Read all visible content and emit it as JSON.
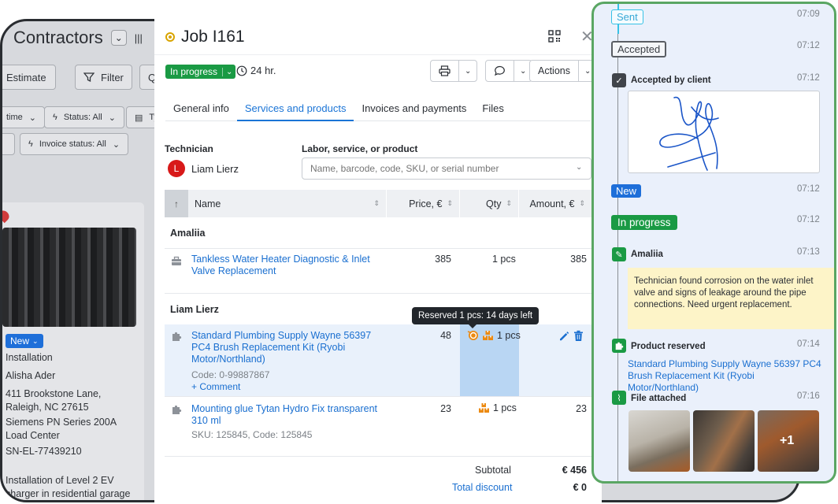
{
  "background_app": {
    "title": "Contractors",
    "buttons": {
      "estimate": "Estimate",
      "filter": "Filter",
      "q_fragment": "Q",
      "time_filter": "time",
      "status_filter": "Status: All",
      "type_fragment": "Ty",
      "invoice_status_filter": "Invoice status: All"
    },
    "card": {
      "status": "New",
      "type": "Installation",
      "customer": "Alisha Ader",
      "address": "411 Brookstone Lane, Raleigh, NC 27615",
      "equipment": "Siemens PN Series 200A Load Center",
      "serial": "SN-EL-77439210",
      "description": "Installation of Level 2 EV charger in residential garage"
    }
  },
  "job": {
    "title": "Job I161",
    "status": "In progress",
    "sla": "24 hr.",
    "actions_label": "Actions",
    "tabs": [
      "General info",
      "Services and products",
      "Invoices and payments",
      "Files"
    ],
    "active_tab": 1,
    "technician": {
      "label": "Technician",
      "name": "Liam Lierz",
      "initial": "L"
    },
    "labor": {
      "label": "Labor, service, or product",
      "placeholder": "Name, barcode, code, SKU, or serial number"
    },
    "table": {
      "columns": [
        "Name",
        "Price, €",
        "Qty",
        "Amount, €"
      ],
      "groups": [
        {
          "name": "Amaliia",
          "rows": [
            {
              "name": "Tankless Water Heater Diagnostic & Inlet Valve Replacement",
              "price": "385",
              "qty": "1 pcs",
              "amount": "385"
            }
          ]
        },
        {
          "name": "Liam Lierz",
          "rows": [
            {
              "name": "Standard Plumbing Supply Wayne 56397 PC4 Brush Replacement Kit (Ryobi Motor/Northland)",
              "code": "Code: 0-99887867",
              "comment": "+ Comment",
              "price": "48",
              "qty": "1 pcs",
              "amount": ""
            },
            {
              "name": "Mounting glue Tytan Hydro Fix transparent 310 ml",
              "code": "SKU: 125845, Code: 125845",
              "price": "23",
              "qty": "1 pcs",
              "amount": "23"
            }
          ]
        }
      ]
    },
    "tooltip": "Reserved 1 pcs: 14 days left",
    "totals": {
      "subtotal_label": "Subtotal",
      "subtotal_value": "€ 456",
      "discount_label": "Total discount",
      "discount_value": "€ 0"
    }
  },
  "timeline": {
    "events": [
      {
        "label": "Sent",
        "time": "07:09"
      },
      {
        "label": "Accepted",
        "time": "07:12"
      },
      {
        "label": "Accepted by client",
        "time": "07:12"
      },
      {
        "label": "New",
        "time": "07:12"
      },
      {
        "label": "In progress",
        "time": "07:12"
      },
      {
        "label": "Amaliia",
        "time": "07:13",
        "note": "Technician found corrosion on the water inlet valve and signs of leakage around the pipe connections. Need urgent replacement."
      },
      {
        "label": "Product reserved",
        "time": "07:14",
        "link": "Standard Plumbing Supply Wayne 56397 PC4 Brush Replacement Kit (Ryobi Motor/Northland)"
      },
      {
        "label": "File attached",
        "time": "07:16",
        "more": "+1"
      }
    ]
  },
  "colors": {
    "accent": "#1a74d6",
    "success": "#1a9a44",
    "danger": "#d81919",
    "warning": "#e8890c",
    "panel_border": "#5aa663"
  },
  "icons": [
    "qr-code-icon",
    "close-icon",
    "clock-icon",
    "printer-icon",
    "chat-icon",
    "wrench-icon",
    "puzzle-icon",
    "reserve-icon",
    "warehouse-icon",
    "pencil-icon",
    "trash-icon",
    "check-icon",
    "note-icon",
    "paperclip-icon"
  ]
}
